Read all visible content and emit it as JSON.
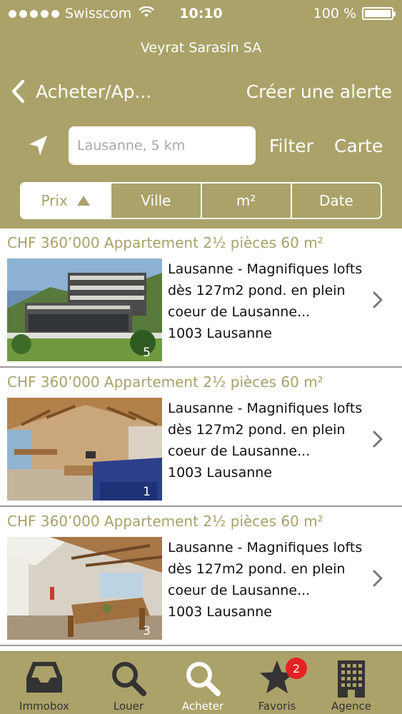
{
  "status_bar": {
    "carrier": "Swisscom",
    "time": "10:10",
    "battery": "100 %",
    "battery_level": 1.0
  },
  "agency_name": "Veyrat Sarasin SA",
  "nav": {
    "back_label": "Acheter/Ap...",
    "create_alert": "Créer une alerte"
  },
  "search": {
    "placeholder": "Lausanne, 5 km",
    "filter_label": "Filter",
    "map_label": "Carte"
  },
  "sort_options": [
    {
      "label": "Prix",
      "active": true,
      "direction": "ascending"
    },
    {
      "label": "Ville",
      "active": false
    },
    {
      "label": "m²",
      "active": false
    },
    {
      "label": "Date",
      "active": false
    }
  ],
  "listings": [
    {
      "title": "CHF 360’000 Appartement 2½ pièces 60 m²",
      "description": "Lausanne - Magnifiques lofts dès 127m2 pond. en plein coeur de Lausanne...",
      "zip_city": "1003 Lausanne",
      "photo_count": "5",
      "image": "modern-building-exterior"
    },
    {
      "title": "CHF 360’000 Appartement 2½ pièces 60 m²",
      "description": "Lausanne - Magnifiques lofts dès 127m2 pond. en plein coeur de Lausanne...",
      "zip_city": "1003 Lausanne",
      "photo_count": "1",
      "image": "attic-living-room"
    },
    {
      "title": "CHF 360’000 Appartement 2½ pièces 60 m²",
      "description": "Lausanne - Magnifiques lofts dès 127m2 pond. en plein coeur de Lausanne...",
      "zip_city": "1003 Lausanne",
      "photo_count": "3",
      "image": "attic-dining-room"
    }
  ],
  "tabs": [
    {
      "label": "Immobox",
      "icon": "inbox-icon",
      "active": false
    },
    {
      "label": "Louer",
      "icon": "search-icon",
      "active": false
    },
    {
      "label": "Acheter",
      "icon": "search-icon",
      "active": true
    },
    {
      "label": "Favoris",
      "icon": "star-icon",
      "active": false,
      "badge": "2"
    },
    {
      "label": "Agence",
      "icon": "building-icon",
      "active": false
    }
  ],
  "colors": {
    "brand": "#aba26a",
    "title_text": "#a9a169",
    "badge": "#e52223"
  }
}
